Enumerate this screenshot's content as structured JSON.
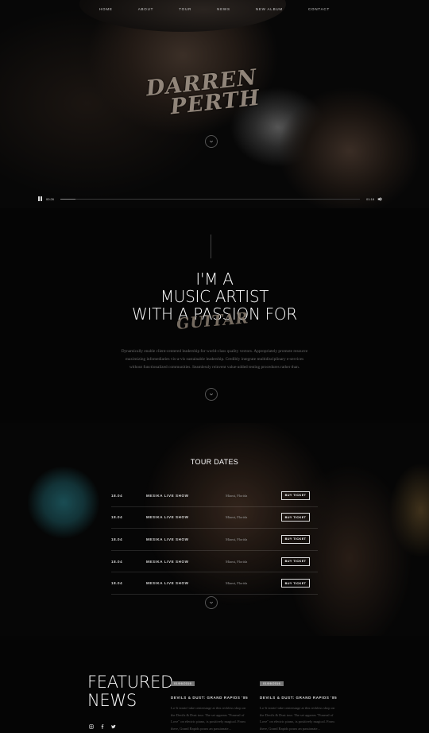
{
  "nav": [
    "Home",
    "About",
    "Tour",
    "News",
    "New Album",
    "Contact"
  ],
  "hero": {
    "brand_line1": "DARREN",
    "brand_line2": "PERTH",
    "player": {
      "elapsed": "00:26",
      "duration": "01:18",
      "progress": 0.05
    }
  },
  "about": {
    "line1": "I'M A",
    "line2": "MUSIC ARTIST",
    "line3": "WITH A PASSION FOR",
    "script": "GUITAR",
    "bio": "Dynamically enable client-centered leadership for world-class quality vectors. Appropriately promote resource maximizing infomediaries vis-a-vis sustainable leadership. Credibly integrate multidisciplinary e-services without functionalized communities. Seamlessly reinvent value-added testing procedures rather than."
  },
  "tour": {
    "title": "TOUR DATES",
    "button_label": "BUY TICKET",
    "rows": [
      {
        "date": "18.04",
        "venue": "MESIKA LIVE SHOW",
        "city": "Miami, Florida"
      },
      {
        "date": "18.04",
        "venue": "MESIKA LIVE SHOW",
        "city": "Miami, Florida"
      },
      {
        "date": "18.04",
        "venue": "MESIKA LIVE SHOW",
        "city": "Miami, Florida"
      },
      {
        "date": "18.04",
        "venue": "MESIKA LIVE SHOW",
        "city": "Miami, Florida"
      },
      {
        "date": "18.04",
        "venue": "MESIKA LIVE SHOW",
        "city": "Miami, Florida"
      }
    ]
  },
  "news": {
    "heading_line1": "FEATURED",
    "heading_line2": "NEWS",
    "cards": [
      {
        "tag": "01/06/2016",
        "title": "DEVILS & DUST: GRAND RAPIDS '85",
        "excerpt": "Lo-fi tearin' take centerstage at this reckless shop on the Devils & Dust tour. The set appears \"Funeral of Love\" on electric piano, is positively magical. From there, Grand Rapids pours an passionate..."
      },
      {
        "tag": "01/06/2016",
        "title": "DEVILS & DUST: GRAND RAPIDS '85",
        "excerpt": "Lo-fi tearin' take centerstage at this reckless shop on the Devils & Dust tour. The set appears \"Funeral of Love\" on electric piano, is positively magical. From there, Grand Rapids pours an passionate..."
      }
    ]
  },
  "icons": [
    "pause-icon",
    "volume-icon",
    "chevron-down-icon",
    "instagram-icon",
    "facebook-icon",
    "twitter-icon"
  ]
}
